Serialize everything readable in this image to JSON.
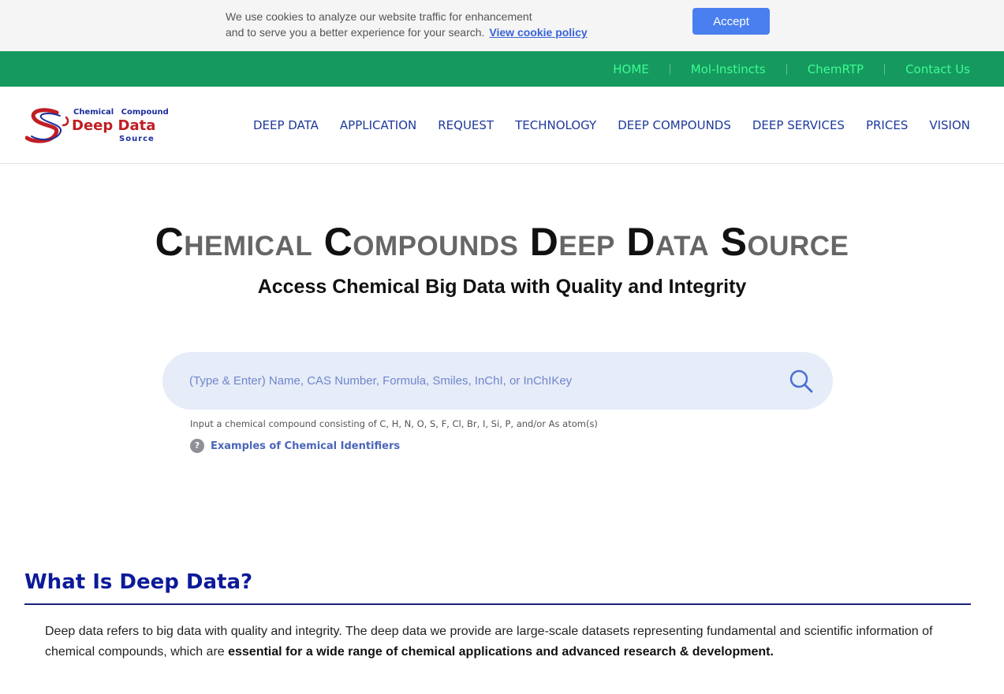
{
  "cookie_banner": {
    "line1": "We use cookies to analyze our website traffic for enhancement",
    "line2": "and to serve you a better experience for your search.",
    "policy_link": "View cookie policy",
    "accept_label": "Accept"
  },
  "top_nav": {
    "items": [
      "HOME",
      "Mol-Instincts",
      "ChemRTP",
      "Contact Us"
    ]
  },
  "logo": {
    "top": "Chemical Compound",
    "middle": "Deep Data",
    "bottom": "Source"
  },
  "main_nav": {
    "items": [
      "DEEP DATA",
      "APPLICATION",
      "REQUEST",
      "TECHNOLOGY",
      "DEEP COMPOUNDS",
      "DEEP SERVICES",
      "PRICES",
      "VISION"
    ]
  },
  "hero": {
    "title_words": [
      {
        "cap": "C",
        "rest": "hemical"
      },
      {
        "cap": "C",
        "rest": "ompounds"
      },
      {
        "cap": "D",
        "rest": "eep"
      },
      {
        "cap": "D",
        "rest": "ata"
      },
      {
        "cap": "S",
        "rest": "ource"
      }
    ],
    "subtitle": "Access Chemical Big Data with Quality and Integrity"
  },
  "search": {
    "placeholder": "(Type & Enter) Name, CAS Number, Formula, Smiles, InChI, or InChIKey",
    "value": "",
    "hint": "Input a chemical compound consisting of C, H, N, O, S, F, Cl, Br, I, Si, P, and/or As atom(s)",
    "examples_icon": "?",
    "examples_link": "Examples of Chemical Identifiers"
  },
  "deep_data_section": {
    "title": "What Is Deep Data?",
    "body_plain": "Deep data refers to big data with quality and integrity. The deep data we provide are large-scale datasets representing fundamental and scientific information of chemical compounds, which are ",
    "body_bold": "essential for a wide range of chemical applications and advanced research & development."
  },
  "colors": {
    "top_nav_bg": "#16995f",
    "top_nav_link": "#3dfc93",
    "main_nav_link": "#1e3a9b",
    "accept_button": "#4a7ff0",
    "search_bg": "#e6ecf8",
    "section_title": "#0c1a9a",
    "logo_red": "#c01e23",
    "logo_blue": "#1a2d9e"
  }
}
